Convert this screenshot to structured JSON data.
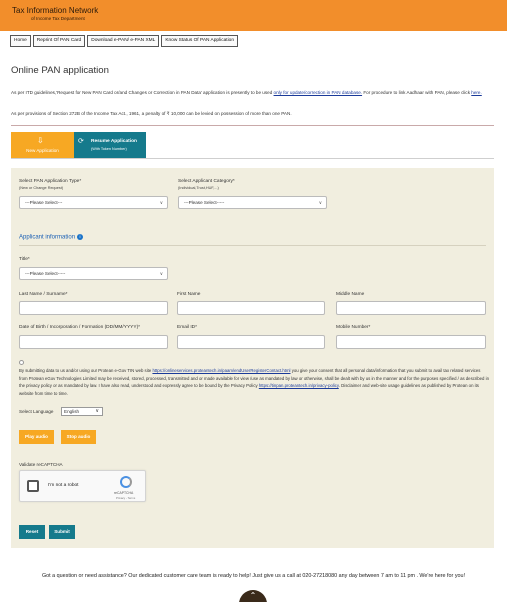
{
  "header": {
    "title": "Tax Information Network",
    "subtitle": "of Income Tax Department"
  },
  "nav": [
    "Home",
    "Reprint Of PAN Card",
    "Download e-PAN/ e-PAN XML",
    "Know Status Of PAN Application"
  ],
  "page_title": "Online PAN application",
  "notes": {
    "n1_a": "As per ITD guidelines,'Request for New PAN Card or/and Changes or Correction in PAN Data' application is presently to be used ",
    "n1_u": "only for update/correction in PAN database.",
    "n1_b": " For procedure to link Aadhaar with PAN, please click ",
    "n1_here": "here.",
    "n2": "As per provisions of Section 272B of the Income Tax Act., 1961, a penalty of ₹ 10,000 can be levied on possession of more than one PAN."
  },
  "tabs": {
    "new_icon": "⇩",
    "new_label": "New Application",
    "resume_icon": "⟳",
    "resume_label": "Resume Application",
    "resume_sub": "(With Token Number)"
  },
  "form": {
    "app_type_label": "Select PAN Application Type*",
    "app_type_sub": "(New or Change Request)",
    "app_type_value": "---Please Select---",
    "category_label": "Select Applicant Category*",
    "category_sub": "(Individual,Trust,HUF,...)",
    "category_value": "---Please Select-----",
    "section_title": "Applicant information",
    "info_icon": "i",
    "title_label": "Title*",
    "title_value": "---Please Select-----",
    "last_name_label": "Last Name / Surname*",
    "first_name_label": "First Name",
    "middle_name_label": "Middle Name",
    "dob_label": "Date of Birth / Incorporation / Formation (DD/MM/YYYY)*",
    "email_label": "Email ID*",
    "mobile_label": "Mobile Number*",
    "consent_a": "By submitting data to us and/or using our Protean e-Gov TIN web site ",
    "consent_link1": "https://onlineservices.proteantech.in/paam/endUserRegisterContact.html",
    "consent_b": " you give your consent that all personal data/information that you submit to avail tax related services from Protean eGov Technologies Limited may be received, stored, processed, transmitted and or made available for view /use as mandated by law or otherwise, shall be dealt with by us in the manner and for the purposes specified / as described in the privacy policy or as mandated by law. I have also read, understood and expressly agree to be bound by the Privacy Policy ",
    "consent_link2": "https://tinpan.proteantech.in/privacy-policy",
    "consent_c": ". Disclaimer and web-site usage guidelines as published by Protean on its website from time to time.",
    "language_label": "Select Language",
    "language_value": "English",
    "play_audio": "Play audio",
    "stop_audio": "Stop audio",
    "validate_label": "Validate reCAPTCHA",
    "captcha_text": "I'm not a robot",
    "captcha_brand": "reCAPTCHA",
    "captcha_links": "Privacy - Terms",
    "reset": "Reset",
    "submit": "Submit"
  },
  "footer": "Got a question or need assistance? Our dedicated customer care team is ready to help! Just give us a call at 020-27218080 any day between 7 am to 11 pm . We're here for you!",
  "scroll_top_icon": "chevron-up-icon",
  "scroll_top_glyph": "⌃",
  "colors": {
    "orange": "#f28e2b",
    "button_orange": "#f7a823",
    "teal": "#157a8c",
    "panel": "#f1eedf"
  }
}
